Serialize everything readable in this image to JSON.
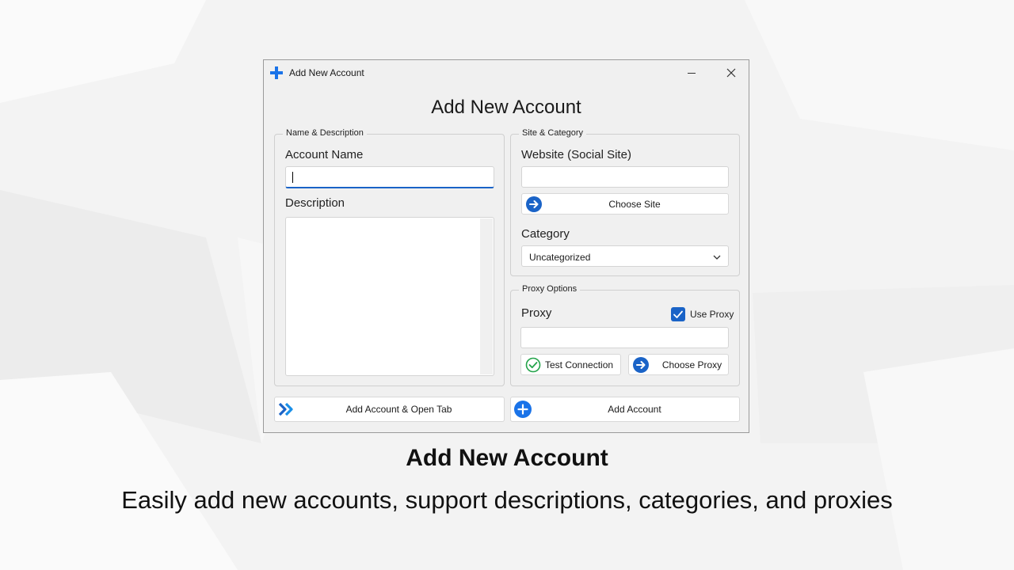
{
  "window": {
    "title": "Add New Account",
    "heading": "Add New Account"
  },
  "name_group": {
    "legend": "Name & Description",
    "account_name_label": "Account Name",
    "account_name_value": "",
    "description_label": "Description",
    "description_value": ""
  },
  "site_group": {
    "legend": "Site & Category",
    "website_label": "Website (Social Site)",
    "website_value": "",
    "choose_site_button": "Choose Site",
    "category_label": "Category",
    "category_selected": "Uncategorized"
  },
  "proxy_group": {
    "legend": "Proxy Options",
    "proxy_label": "Proxy",
    "use_proxy_label": "Use Proxy",
    "use_proxy_checked": true,
    "proxy_value": "",
    "test_connection_button": "Test Connection",
    "choose_proxy_button": "Choose Proxy"
  },
  "footer": {
    "add_and_open_button": "Add Account & Open Tab",
    "add_button": "Add Account"
  },
  "caption": {
    "title": "Add New Account",
    "subtitle": "Easily add new accounts, support descriptions, categories, and proxies"
  },
  "icons": {
    "app": "plus-icon",
    "choose_site": "arrow-right-circle-icon",
    "test_connection": "check-circle-icon",
    "choose_proxy": "arrow-right-circle-icon",
    "add_and_open": "double-chevron-right-icon",
    "add": "plus-circle-icon"
  },
  "colors": {
    "accent": "#1a63c7",
    "success": "#23a34a"
  }
}
